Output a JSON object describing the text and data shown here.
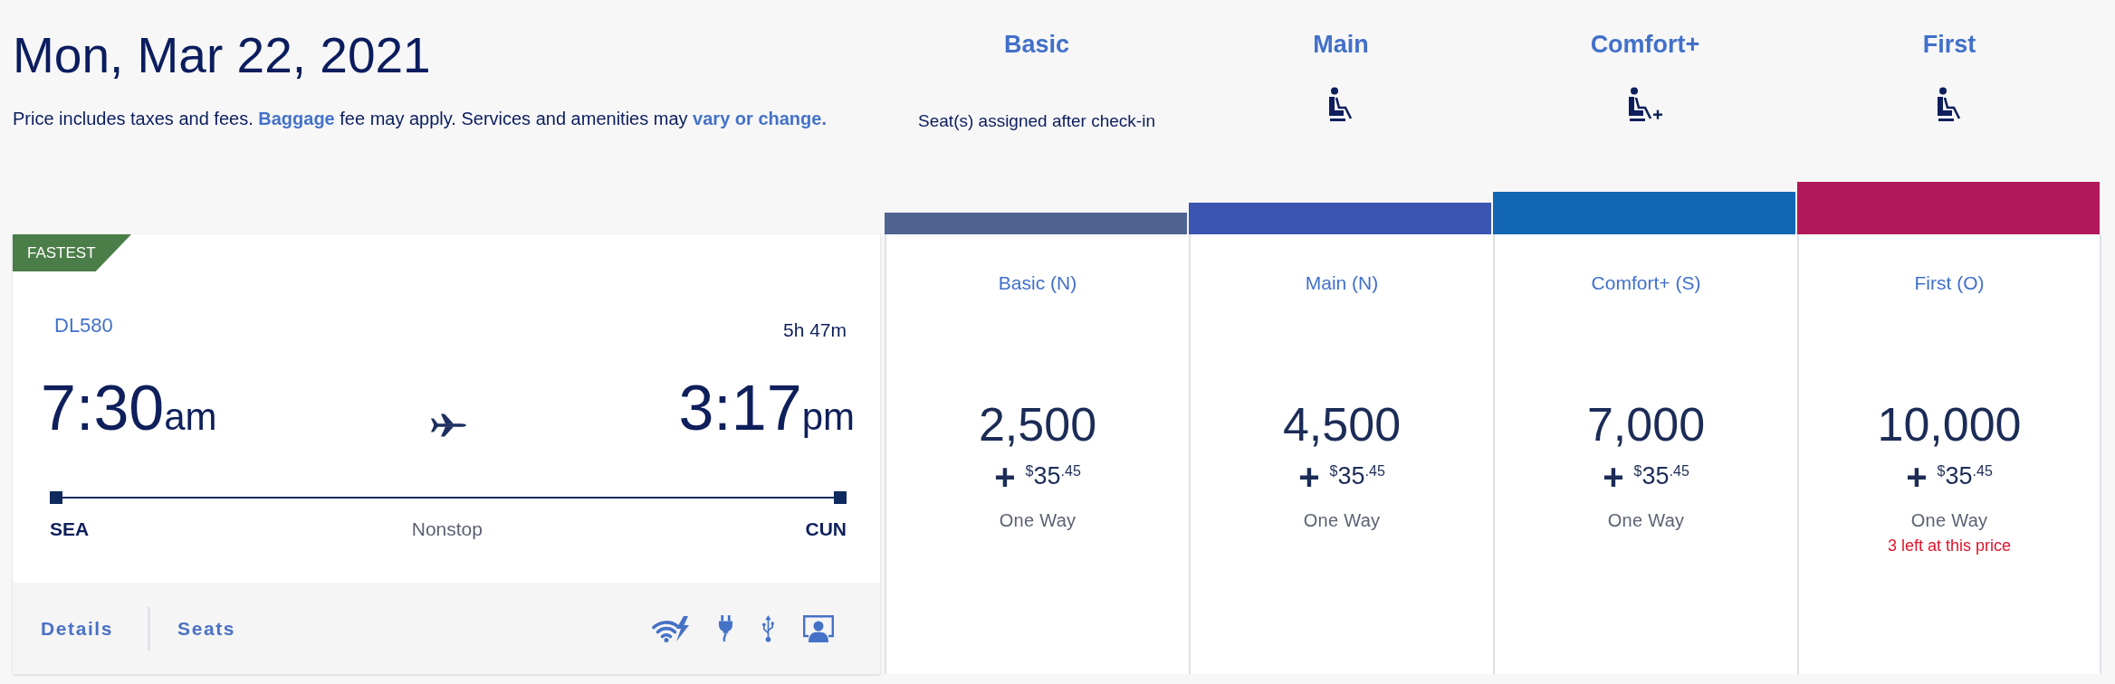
{
  "header": {
    "title": "Mon, Mar 22, 2021",
    "notice": [
      {
        "kind": "text",
        "text": "Price includes taxes and fees. "
      },
      {
        "kind": "link",
        "text": "Baggage"
      },
      {
        "kind": "text",
        "text": " fee may apply. Services and amenities may "
      },
      {
        "kind": "link",
        "text": "vary or change."
      }
    ]
  },
  "cabins": [
    {
      "name": "Basic",
      "kind": "note",
      "note": "Seat(s) assigned after check-in",
      "color": "#4f6393"
    },
    {
      "name": "Main",
      "kind": "seat",
      "color": "#3a56b0"
    },
    {
      "name": "Comfort+",
      "kind": "seat-plus",
      "color": "#1266b3"
    },
    {
      "name": "First",
      "kind": "seat",
      "color": "#b3185a"
    }
  ],
  "flight": {
    "badge": "FASTEST",
    "flight_number": "DL580",
    "duration": "5h 47m",
    "depart": {
      "time": "7:30",
      "period": "am",
      "airport": "SEA"
    },
    "arrive": {
      "time": "3:17",
      "period": "pm",
      "airport": "CUN"
    },
    "stops": "Nonstop",
    "links": [
      "Details",
      "Seats"
    ]
  },
  "fares": [
    {
      "fare_class": "Basic (N)",
      "miles": "2,500",
      "plus": "+",
      "currency": "$",
      "dollars": "35",
      "cents": ".45",
      "trip": "One Way"
    },
    {
      "fare_class": "Main (N)",
      "miles": "4,500",
      "plus": "+",
      "currency": "$",
      "dollars": "35",
      "cents": ".45",
      "trip": "One Way"
    },
    {
      "fare_class": "Comfort+ (S)",
      "miles": "7,000",
      "plus": "+",
      "currency": "$",
      "dollars": "35",
      "cents": ".45",
      "trip": "One Way"
    },
    {
      "fare_class": "First (O)",
      "miles": "10,000",
      "plus": "+",
      "currency": "$",
      "dollars": "35",
      "cents": ".45",
      "trip": "One Way",
      "availability": "3 left at this price"
    }
  ]
}
